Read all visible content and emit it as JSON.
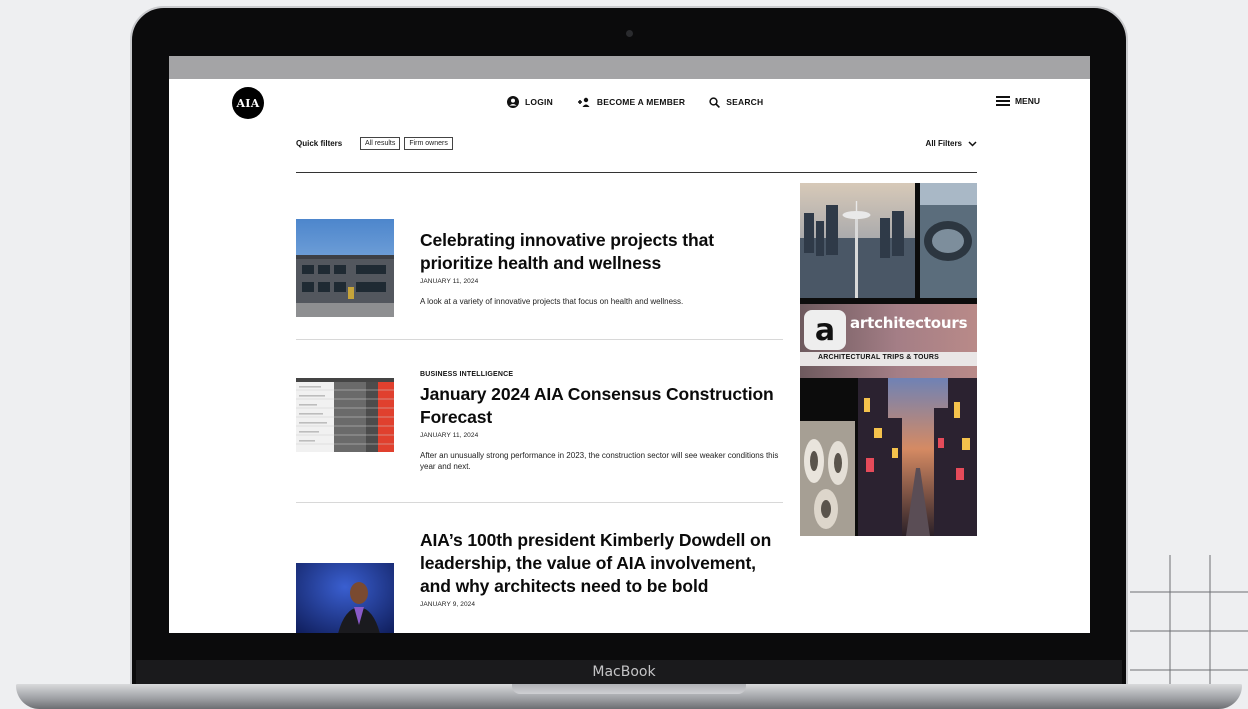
{
  "header": {
    "logo": "AIA",
    "nav": [
      {
        "label": "LOGIN",
        "icon": "user-circle-icon"
      },
      {
        "label": "BECOME A MEMBER",
        "icon": "add-user-icon"
      },
      {
        "label": "SEARCH",
        "icon": "search-icon"
      }
    ],
    "menu_label": "MENU"
  },
  "filters": {
    "label": "Quick filters",
    "chips": [
      "All results",
      "Firm owners"
    ],
    "all_filters": "All Filters"
  },
  "articles": [
    {
      "kicker": "",
      "title": "Celebrating innovative projects that prioritize health and wellness",
      "date": "JANUARY 11, 2024",
      "description": "A look at a variety of innovative projects that focus on health and wellness."
    },
    {
      "kicker": "BUSINESS INTELLIGENCE",
      "title": "January 2024 AIA Consensus Construction Forecast",
      "date": "JANUARY 11, 2024",
      "description": "After an unusually strong performance in 2023, the construction sector will see weaker conditions this year and next."
    },
    {
      "kicker": "",
      "title": "AIA’s 100th president Kimberly Dowdell on leadership, the value of AIA involvement, and why architects need to be bold",
      "date": "JANUARY 9, 2024",
      "description": ""
    }
  ],
  "ad": {
    "logo_letter": "a",
    "brand": "artchitectours",
    "tagline": "ARCHITECTURAL TRIPS & TOURS"
  },
  "device": {
    "label": "MacBook"
  },
  "colors": {
    "accent_red": "#e0402e",
    "browser_bar": "#a4a4a6",
    "text": "#0b0b0b"
  }
}
